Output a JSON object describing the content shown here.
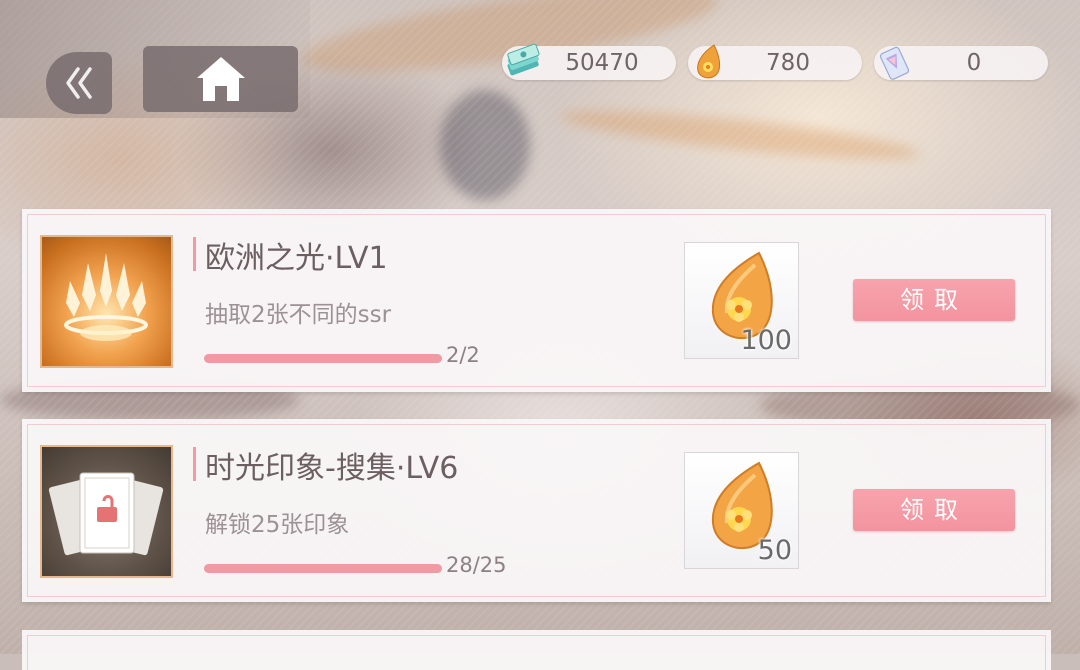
{
  "currencies": [
    {
      "icon": "cash-stack-icon",
      "value": "50470"
    },
    {
      "icon": "amber-gem-icon",
      "value": "780"
    },
    {
      "icon": "crystal-ticket-icon",
      "value": "0"
    }
  ],
  "tasks": [
    {
      "title": "欧洲之光·LV1",
      "description": "抽取2张不同的ssr",
      "progress": "2/2",
      "progress_ratio": 1.0,
      "reward_icon": "amber-gem-icon",
      "reward_qty": "100",
      "claim_label": "领取",
      "badge_icon": "crown-icon"
    },
    {
      "title": "时光印象-搜集·LV6",
      "description": "解锁25张印象",
      "progress": "28/25",
      "progress_ratio": 1.0,
      "reward_icon": "amber-gem-icon",
      "reward_qty": "50",
      "claim_label": "领取",
      "badge_icon": "unlocked-cards-icon"
    }
  ],
  "colors": {
    "accent_pink": "#f3949f",
    "card_bg": "#f9f6f7",
    "text_dark": "#6b5f62"
  }
}
